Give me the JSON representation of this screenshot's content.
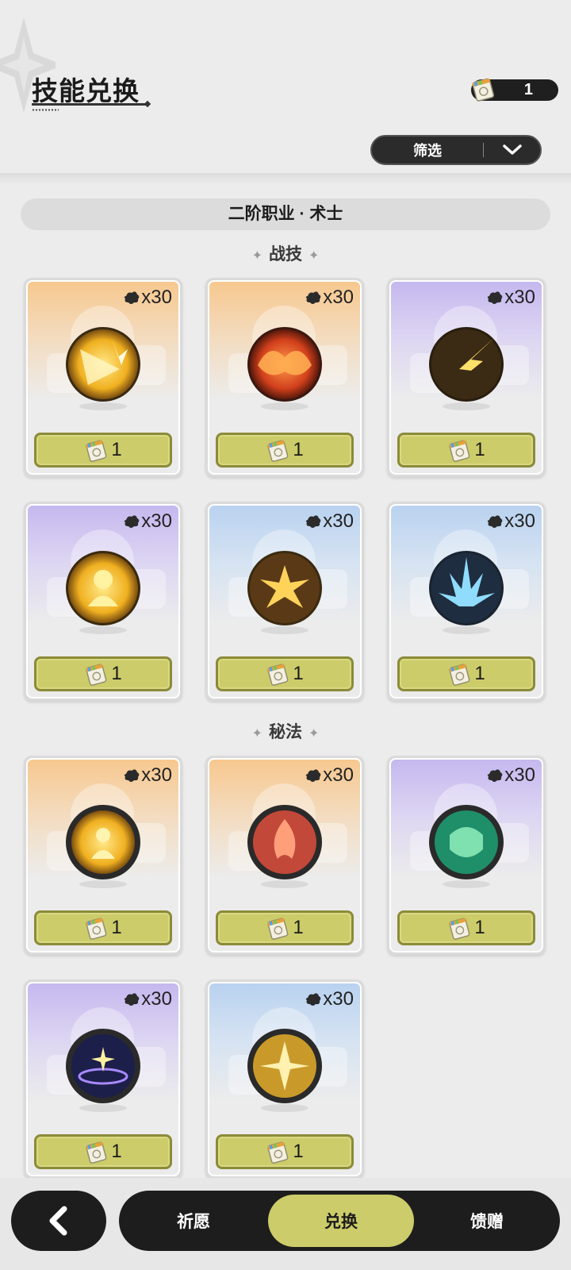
{
  "header": {
    "title": "技能兑换"
  },
  "currency": {
    "icon": "ticket-icon",
    "value": "1"
  },
  "filter": {
    "label": "筛选"
  },
  "category": {
    "title": "二阶职业 · 术士"
  },
  "sections": {
    "combat": {
      "title": "战技"
    },
    "arcane": {
      "title": "秘法"
    }
  },
  "cards": [
    {
      "qty": "x30",
      "price": "1",
      "theme": "orange",
      "icon": "light-burst-icon"
    },
    {
      "qty": "x30",
      "price": "1",
      "theme": "orange",
      "icon": "fire-burst-icon"
    },
    {
      "qty": "x30",
      "price": "1",
      "theme": "purple",
      "icon": "lightning-strike-icon"
    },
    {
      "qty": "x30",
      "price": "1",
      "theme": "purple",
      "icon": "golden-figure-icon"
    },
    {
      "qty": "x30",
      "price": "1",
      "theme": "blue",
      "icon": "explosion-icon"
    },
    {
      "qty": "x30",
      "price": "1",
      "theme": "blue",
      "icon": "ice-crystal-icon"
    },
    {
      "qty": "x30",
      "price": "1",
      "theme": "orange",
      "icon": "shield-figure-icon"
    },
    {
      "qty": "x30",
      "price": "1",
      "theme": "orange",
      "icon": "red-flame-icon"
    },
    {
      "qty": "x30",
      "price": "1",
      "theme": "purple",
      "icon": "green-chain-icon"
    },
    {
      "qty": "x30",
      "price": "1",
      "theme": "purple",
      "icon": "magic-circle-icon"
    },
    {
      "qty": "x30",
      "price": "1",
      "theme": "blue",
      "icon": "golden-shatter-icon"
    }
  ],
  "nav": {
    "tabs": [
      {
        "label": "祈愿"
      },
      {
        "label": "兑换"
      },
      {
        "label": "馈赠"
      }
    ],
    "active": "兑换"
  },
  "colors": {
    "accent": "#cccc6a",
    "dark": "#1d1d1d",
    "background": "#ececec"
  }
}
